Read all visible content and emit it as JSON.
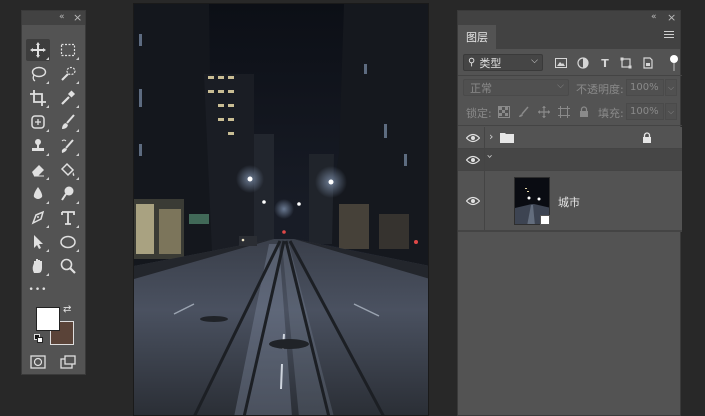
{
  "tools_panel": {
    "collapse_glyph": "«",
    "close_glyph": "×",
    "more_glyph": "•••",
    "swap_glyph": "⇄",
    "tools": [
      {
        "id": "move",
        "icon": "move-icon",
        "selected": true
      },
      {
        "id": "marquee",
        "icon": "rect-marquee-icon"
      },
      {
        "id": "lasso",
        "icon": "lasso-icon"
      },
      {
        "id": "quick-select",
        "icon": "quick-select-icon"
      },
      {
        "id": "crop",
        "icon": "crop-icon"
      },
      {
        "id": "eyedropper",
        "icon": "eyedropper-icon"
      },
      {
        "id": "healing",
        "icon": "healing-brush-icon"
      },
      {
        "id": "brush",
        "icon": "brush-icon"
      },
      {
        "id": "clone",
        "icon": "clone-stamp-icon"
      },
      {
        "id": "history-brush",
        "icon": "history-brush-icon"
      },
      {
        "id": "eraser",
        "icon": "eraser-icon"
      },
      {
        "id": "bucket",
        "icon": "paint-bucket-icon"
      },
      {
        "id": "blur",
        "icon": "blur-icon"
      },
      {
        "id": "dodge",
        "icon": "dodge-icon"
      },
      {
        "id": "pen",
        "icon": "pen-icon"
      },
      {
        "id": "type",
        "icon": "type-icon"
      },
      {
        "id": "path-select",
        "icon": "path-select-icon"
      },
      {
        "id": "ellipse",
        "icon": "ellipse-icon"
      },
      {
        "id": "hand",
        "icon": "hand-icon"
      },
      {
        "id": "zoom",
        "icon": "zoom-icon"
      }
    ],
    "foreground_color": "#ffffff",
    "background_color": "#5a4338"
  },
  "layers_panel": {
    "collapse_glyph": "«",
    "close_glyph": "×",
    "tab_label": "图层",
    "filter": {
      "label": "类型",
      "icons": [
        "image-filter-icon",
        "adjustment-filter-icon",
        "type-filter-icon",
        "shape-filter-icon",
        "smart-object-filter-icon"
      ],
      "type_glyph": "T"
    },
    "blend_mode": "正常",
    "opacity_label": "不透明度:",
    "opacity_value": "100%",
    "lock_label": "锁定:",
    "fill_label": "填充:",
    "fill_value": "100%",
    "layers": [
      {
        "kind": "group",
        "name": "",
        "locked": true,
        "visible": true
      },
      {
        "kind": "group-expanded",
        "name": "",
        "visible": true
      },
      {
        "kind": "smart-object",
        "name": "城市",
        "visible": true
      }
    ]
  },
  "colors": {
    "workspace": "#282828",
    "panel": "#535353",
    "panel_header": "#424242",
    "selected_row": "#464646"
  }
}
